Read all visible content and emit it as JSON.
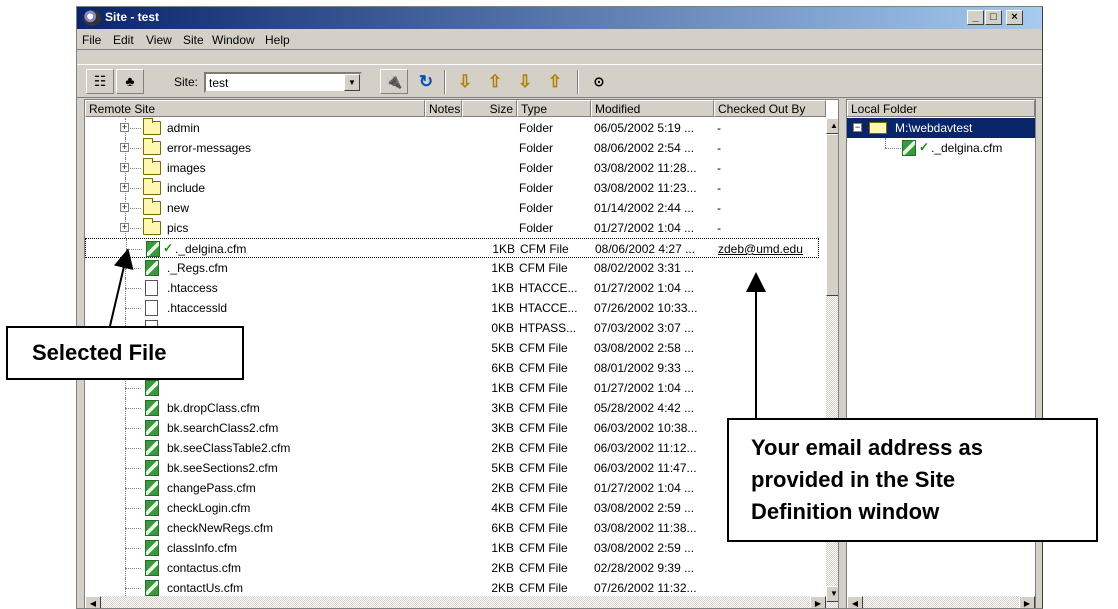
{
  "window": {
    "title": "Site - test",
    "controls": [
      "_",
      "□",
      "×"
    ]
  },
  "menu": [
    "File",
    "Edit",
    "View",
    "Site",
    "Window",
    "Help"
  ],
  "toolbar": {
    "site_label": "Site:",
    "site_value": "test",
    "buttons": [
      "site-files-view",
      "site-map-view",
      "connect",
      "refresh",
      "get",
      "put",
      "check-out",
      "check-in",
      "help"
    ]
  },
  "remote": {
    "headers": [
      "Remote Site",
      "Notes",
      "Size",
      "Type",
      "Modified",
      "Checked Out By"
    ],
    "rows": [
      {
        "kind": "folder",
        "name": "admin",
        "size": "",
        "type": "Folder",
        "modified": "06/05/2002 5:19 ...",
        "checked": "-"
      },
      {
        "kind": "folder",
        "name": "error-messages",
        "size": "",
        "type": "Folder",
        "modified": "08/06/2002 2:54 ...",
        "checked": "-"
      },
      {
        "kind": "folder",
        "name": "images",
        "size": "",
        "type": "Folder",
        "modified": "03/08/2002 11:28...",
        "checked": "-"
      },
      {
        "kind": "folder",
        "name": "include",
        "size": "",
        "type": "Folder",
        "modified": "03/08/2002 11:23...",
        "checked": "-"
      },
      {
        "kind": "folder",
        "name": "new",
        "size": "",
        "type": "Folder",
        "modified": "01/14/2002 2:44 ...",
        "checked": "-"
      },
      {
        "kind": "folder",
        "name": "pics",
        "size": "",
        "type": "Folder",
        "modified": "01/27/2002 1:04 ...",
        "checked": "-"
      },
      {
        "kind": "cfm-checked",
        "name": "._delgina.cfm",
        "size": "1KB",
        "type": "CFM File",
        "modified": "08/06/2002 4:27 ...",
        "checked": "zdeb@umd.edu"
      },
      {
        "kind": "cfm",
        "name": "._Regs.cfm",
        "size": "1KB",
        "type": "CFM File",
        "modified": "08/02/2002 3:31 ...",
        "checked": ""
      },
      {
        "kind": "file",
        "name": ".htaccess",
        "size": "1KB",
        "type": "HTACCE...",
        "modified": "01/27/2002 1:04 ...",
        "checked": ""
      },
      {
        "kind": "file",
        "name": ".htaccessld",
        "size": "1KB",
        "type": "HTACCE...",
        "modified": "07/26/2002 10:33...",
        "checked": ""
      },
      {
        "kind": "file",
        "name": "",
        "size": "0KB",
        "type": "HTPASS...",
        "modified": "07/03/2002 3:07 ...",
        "checked": ""
      },
      {
        "kind": "cfm",
        "name": "",
        "size": "5KB",
        "type": "CFM File",
        "modified": "03/08/2002 2:58 ...",
        "checked": ""
      },
      {
        "kind": "cfm",
        "name": "",
        "size": "6KB",
        "type": "CFM File",
        "modified": "08/01/2002 9:33 ...",
        "checked": ""
      },
      {
        "kind": "cfm",
        "name": "",
        "size": "1KB",
        "type": "CFM File",
        "modified": "01/27/2002 1:04 ...",
        "checked": ""
      },
      {
        "kind": "cfm",
        "name": "bk.dropClass.cfm",
        "size": "3KB",
        "type": "CFM File",
        "modified": "05/28/2002 4:42 ...",
        "checked": ""
      },
      {
        "kind": "cfm",
        "name": "bk.searchClass2.cfm",
        "size": "3KB",
        "type": "CFM File",
        "modified": "06/03/2002 10:38...",
        "checked": ""
      },
      {
        "kind": "cfm",
        "name": "bk.seeClassTable2.cfm",
        "size": "2KB",
        "type": "CFM File",
        "modified": "06/03/2002 11:12...",
        "checked": ""
      },
      {
        "kind": "cfm",
        "name": "bk.seeSections2.cfm",
        "size": "5KB",
        "type": "CFM File",
        "modified": "06/03/2002 11:47...",
        "checked": ""
      },
      {
        "kind": "cfm",
        "name": "changePass.cfm",
        "size": "2KB",
        "type": "CFM File",
        "modified": "01/27/2002 1:04 ...",
        "checked": ""
      },
      {
        "kind": "cfm",
        "name": "checkLogin.cfm",
        "size": "4KB",
        "type": "CFM File",
        "modified": "03/08/2002 2:59 ...",
        "checked": ""
      },
      {
        "kind": "cfm",
        "name": "checkNewRegs.cfm",
        "size": "6KB",
        "type": "CFM File",
        "modified": "03/08/2002 11:38...",
        "checked": ""
      },
      {
        "kind": "cfm",
        "name": "classInfo.cfm",
        "size": "1KB",
        "type": "CFM File",
        "modified": "03/08/2002 2:59 ...",
        "checked": ""
      },
      {
        "kind": "cfm",
        "name": "contactus.cfm",
        "size": "2KB",
        "type": "CFM File",
        "modified": "02/28/2002 9:39 ...",
        "checked": ""
      },
      {
        "kind": "cfm",
        "name": "contactUs.cfm",
        "size": "2KB",
        "type": "CFM File",
        "modified": "07/26/2002 11:32...",
        "checked": ""
      }
    ]
  },
  "local": {
    "header": "Local Folder",
    "root": "M:\\webdavtest",
    "file": "._delgina.cfm"
  },
  "annotations": {
    "selected_file": "Selected File",
    "email_lines": [
      "Your email address as",
      "provided in the Site",
      "Definition window"
    ]
  }
}
